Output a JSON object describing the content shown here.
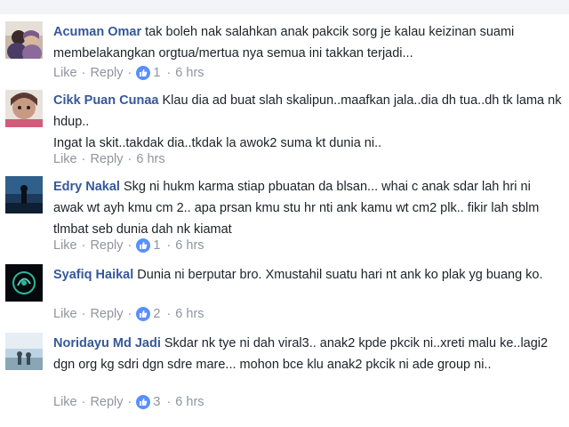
{
  "actions": {
    "like_label": "Like",
    "reply_label": "Reply",
    "separator": "·"
  },
  "comments": [
    {
      "author": "Acuman Omar",
      "text": "tak boleh nak salahkan anak pakcik sorg je kalau keizinan suami membelakangkan orgtua/mertua nya semua ini takkan terjadi...",
      "likes": "1",
      "time": "6 hrs",
      "avatar_icon": "couple-photo"
    },
    {
      "author": "Cikk Puan Cunaa",
      "text": "Klau dia ad buat slah skalipun..maafkan jala..dia dh tua..dh tk lama nk hdup..\nIngat la skit..takdak dia..tkdak la awok2 suma kt dunia ni..",
      "likes": "",
      "time": "6 hrs",
      "avatar_icon": "child-photo"
    },
    {
      "author": "Edry Nakal",
      "text": "Skg ni hukm karma stiap pbuatan da blsan... whai c anak sdar lah hri ni awak wt ayh kmu cm 2.. apa prsan kmu stu hr nti ank kamu wt cm2 plk.. fikir lah sblm tlmbat seb dunia dah nk kiamat",
      "likes": "1",
      "time": "6 hrs",
      "avatar_icon": "silhouette-photo"
    },
    {
      "author": "Syafiq Haikal",
      "text": "Dunia ni berputar bro. Xmustahil suatu hari nt ank ko plak yg buang ko.",
      "likes": "2",
      "time": "6 hrs",
      "avatar_icon": "logo-photo"
    },
    {
      "author": "Noridayu Md Jadi",
      "text": "Skdar nk tye ni dah viral3.. anak2 kpde pkcik ni..xreti malu ke..lagi2 dgn org kg sdri dgn sdre mare... mohon bce klu anak2 pkcik ni ade group ni..",
      "likes": "3",
      "time": "6 hrs",
      "avatar_icon": "landscape-photo"
    }
  ]
}
